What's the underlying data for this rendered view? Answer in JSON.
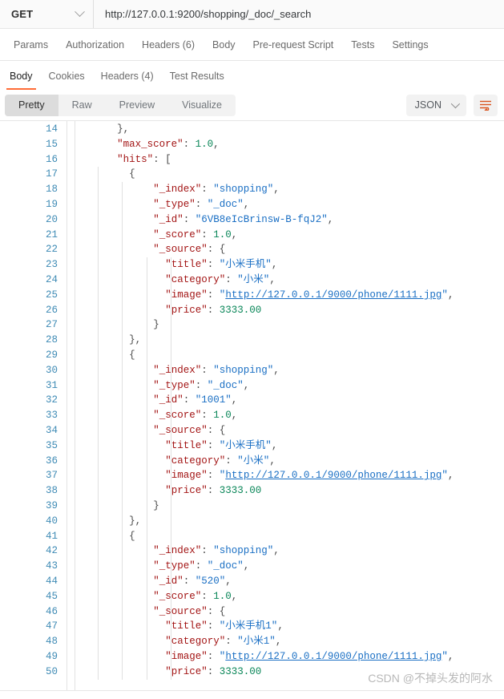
{
  "theme": {
    "accent": "#ff6c37",
    "link": "#1a6fc4",
    "key": "#a31515",
    "number": "#098658",
    "linenum": "#3f8bb5"
  },
  "request_bar": {
    "method": "GET",
    "url": "http://127.0.0.1:9200/shopping/_doc/_search",
    "method_chevron": "chevron-down-icon"
  },
  "request_tabs": [
    {
      "label": "Params"
    },
    {
      "label": "Authorization"
    },
    {
      "label": "Headers (6)"
    },
    {
      "label": "Body"
    },
    {
      "label": "Pre-request Script"
    },
    {
      "label": "Tests"
    },
    {
      "label": "Settings"
    }
  ],
  "response_tabs": [
    {
      "label": "Body",
      "active": true
    },
    {
      "label": "Cookies",
      "active": false
    },
    {
      "label": "Headers (4)",
      "active": false
    },
    {
      "label": "Test Results",
      "active": false
    }
  ],
  "format_bar": {
    "modes": [
      {
        "label": "Pretty",
        "active": true
      },
      {
        "label": "Raw",
        "active": false
      },
      {
        "label": "Preview",
        "active": false
      },
      {
        "label": "Visualize",
        "active": false
      }
    ],
    "language": "JSON",
    "language_chevron": "chevron-down-icon",
    "wrap_button": "wrap-lines-icon"
  },
  "code": {
    "first_line_number": 14,
    "lines": [
      {
        "n": 14,
        "indent": 3,
        "tokens": [
          {
            "t": "},",
            "c": "p"
          }
        ]
      },
      {
        "n": 15,
        "indent": 3,
        "tokens": [
          {
            "t": "\"max_score\"",
            "c": "k"
          },
          {
            "t": ": ",
            "c": "p"
          },
          {
            "t": "1.0",
            "c": "n"
          },
          {
            "t": ",",
            "c": "p"
          }
        ]
      },
      {
        "n": 16,
        "indent": 3,
        "tokens": [
          {
            "t": "\"hits\"",
            "c": "k"
          },
          {
            "t": ": [",
            "c": "p"
          }
        ]
      },
      {
        "n": 17,
        "indent": 4,
        "tokens": [
          {
            "t": "{",
            "c": "p"
          }
        ]
      },
      {
        "n": 18,
        "indent": 6,
        "tokens": [
          {
            "t": "\"_index\"",
            "c": "k"
          },
          {
            "t": ": ",
            "c": "p"
          },
          {
            "t": "\"shopping\"",
            "c": "s"
          },
          {
            "t": ",",
            "c": "p"
          }
        ]
      },
      {
        "n": 19,
        "indent": 6,
        "tokens": [
          {
            "t": "\"_type\"",
            "c": "k"
          },
          {
            "t": ": ",
            "c": "p"
          },
          {
            "t": "\"_doc\"",
            "c": "s"
          },
          {
            "t": ",",
            "c": "p"
          }
        ]
      },
      {
        "n": 20,
        "indent": 6,
        "tokens": [
          {
            "t": "\"_id\"",
            "c": "k"
          },
          {
            "t": ": ",
            "c": "p"
          },
          {
            "t": "\"6VB8eIcBrinsw-B-fqJ2\"",
            "c": "s"
          },
          {
            "t": ",",
            "c": "p"
          }
        ]
      },
      {
        "n": 21,
        "indent": 6,
        "tokens": [
          {
            "t": "\"_score\"",
            "c": "k"
          },
          {
            "t": ": ",
            "c": "p"
          },
          {
            "t": "1.0",
            "c": "n"
          },
          {
            "t": ",",
            "c": "p"
          }
        ]
      },
      {
        "n": 22,
        "indent": 6,
        "tokens": [
          {
            "t": "\"_source\"",
            "c": "k"
          },
          {
            "t": ": {",
            "c": "p"
          }
        ]
      },
      {
        "n": 23,
        "indent": 7,
        "tokens": [
          {
            "t": "\"title\"",
            "c": "k"
          },
          {
            "t": ": ",
            "c": "p"
          },
          {
            "t": "\"小米手机\"",
            "c": "s"
          },
          {
            "t": ",",
            "c": "p"
          }
        ]
      },
      {
        "n": 24,
        "indent": 7,
        "tokens": [
          {
            "t": "\"category\"",
            "c": "k"
          },
          {
            "t": ": ",
            "c": "p"
          },
          {
            "t": "\"小米\"",
            "c": "s"
          },
          {
            "t": ",",
            "c": "p"
          }
        ]
      },
      {
        "n": 25,
        "indent": 7,
        "tokens": [
          {
            "t": "\"image\"",
            "c": "k"
          },
          {
            "t": ": ",
            "c": "p"
          },
          {
            "t": "\"",
            "c": "s"
          },
          {
            "t": "http://127.0.0.1/9000/phone/1111.jpg",
            "c": "lnk"
          },
          {
            "t": "\"",
            "c": "s"
          },
          {
            "t": ",",
            "c": "p"
          }
        ]
      },
      {
        "n": 26,
        "indent": 7,
        "tokens": [
          {
            "t": "\"price\"",
            "c": "k"
          },
          {
            "t": ": ",
            "c": "p"
          },
          {
            "t": "3333.00",
            "c": "n"
          }
        ]
      },
      {
        "n": 27,
        "indent": 6,
        "tokens": [
          {
            "t": "}",
            "c": "p"
          }
        ]
      },
      {
        "n": 28,
        "indent": 4,
        "tokens": [
          {
            "t": "},",
            "c": "p"
          }
        ]
      },
      {
        "n": 29,
        "indent": 4,
        "tokens": [
          {
            "t": "{",
            "c": "p"
          }
        ]
      },
      {
        "n": 30,
        "indent": 6,
        "tokens": [
          {
            "t": "\"_index\"",
            "c": "k"
          },
          {
            "t": ": ",
            "c": "p"
          },
          {
            "t": "\"shopping\"",
            "c": "s"
          },
          {
            "t": ",",
            "c": "p"
          }
        ]
      },
      {
        "n": 31,
        "indent": 6,
        "tokens": [
          {
            "t": "\"_type\"",
            "c": "k"
          },
          {
            "t": ": ",
            "c": "p"
          },
          {
            "t": "\"_doc\"",
            "c": "s"
          },
          {
            "t": ",",
            "c": "p"
          }
        ]
      },
      {
        "n": 32,
        "indent": 6,
        "tokens": [
          {
            "t": "\"_id\"",
            "c": "k"
          },
          {
            "t": ": ",
            "c": "p"
          },
          {
            "t": "\"1001\"",
            "c": "s"
          },
          {
            "t": ",",
            "c": "p"
          }
        ]
      },
      {
        "n": 33,
        "indent": 6,
        "tokens": [
          {
            "t": "\"_score\"",
            "c": "k"
          },
          {
            "t": ": ",
            "c": "p"
          },
          {
            "t": "1.0",
            "c": "n"
          },
          {
            "t": ",",
            "c": "p"
          }
        ]
      },
      {
        "n": 34,
        "indent": 6,
        "tokens": [
          {
            "t": "\"_source\"",
            "c": "k"
          },
          {
            "t": ": {",
            "c": "p"
          }
        ]
      },
      {
        "n": 35,
        "indent": 7,
        "tokens": [
          {
            "t": "\"title\"",
            "c": "k"
          },
          {
            "t": ": ",
            "c": "p"
          },
          {
            "t": "\"小米手机\"",
            "c": "s"
          },
          {
            "t": ",",
            "c": "p"
          }
        ]
      },
      {
        "n": 36,
        "indent": 7,
        "tokens": [
          {
            "t": "\"category\"",
            "c": "k"
          },
          {
            "t": ": ",
            "c": "p"
          },
          {
            "t": "\"小米\"",
            "c": "s"
          },
          {
            "t": ",",
            "c": "p"
          }
        ]
      },
      {
        "n": 37,
        "indent": 7,
        "tokens": [
          {
            "t": "\"image\"",
            "c": "k"
          },
          {
            "t": ": ",
            "c": "p"
          },
          {
            "t": "\"",
            "c": "s"
          },
          {
            "t": "http://127.0.0.1/9000/phone/1111.jpg",
            "c": "lnk"
          },
          {
            "t": "\"",
            "c": "s"
          },
          {
            "t": ",",
            "c": "p"
          }
        ]
      },
      {
        "n": 38,
        "indent": 7,
        "tokens": [
          {
            "t": "\"price\"",
            "c": "k"
          },
          {
            "t": ": ",
            "c": "p"
          },
          {
            "t": "3333.00",
            "c": "n"
          }
        ]
      },
      {
        "n": 39,
        "indent": 6,
        "tokens": [
          {
            "t": "}",
            "c": "p"
          }
        ]
      },
      {
        "n": 40,
        "indent": 4,
        "tokens": [
          {
            "t": "},",
            "c": "p"
          }
        ]
      },
      {
        "n": 41,
        "indent": 4,
        "tokens": [
          {
            "t": "{",
            "c": "p"
          }
        ]
      },
      {
        "n": 42,
        "indent": 6,
        "tokens": [
          {
            "t": "\"_index\"",
            "c": "k"
          },
          {
            "t": ": ",
            "c": "p"
          },
          {
            "t": "\"shopping\"",
            "c": "s"
          },
          {
            "t": ",",
            "c": "p"
          }
        ]
      },
      {
        "n": 43,
        "indent": 6,
        "tokens": [
          {
            "t": "\"_type\"",
            "c": "k"
          },
          {
            "t": ": ",
            "c": "p"
          },
          {
            "t": "\"_doc\"",
            "c": "s"
          },
          {
            "t": ",",
            "c": "p"
          }
        ]
      },
      {
        "n": 44,
        "indent": 6,
        "tokens": [
          {
            "t": "\"_id\"",
            "c": "k"
          },
          {
            "t": ": ",
            "c": "p"
          },
          {
            "t": "\"520\"",
            "c": "s"
          },
          {
            "t": ",",
            "c": "p"
          }
        ]
      },
      {
        "n": 45,
        "indent": 6,
        "tokens": [
          {
            "t": "\"_score\"",
            "c": "k"
          },
          {
            "t": ": ",
            "c": "p"
          },
          {
            "t": "1.0",
            "c": "n"
          },
          {
            "t": ",",
            "c": "p"
          }
        ]
      },
      {
        "n": 46,
        "indent": 6,
        "tokens": [
          {
            "t": "\"_source\"",
            "c": "k"
          },
          {
            "t": ": {",
            "c": "p"
          }
        ]
      },
      {
        "n": 47,
        "indent": 7,
        "tokens": [
          {
            "t": "\"title\"",
            "c": "k"
          },
          {
            "t": ": ",
            "c": "p"
          },
          {
            "t": "\"小米手机1\"",
            "c": "s"
          },
          {
            "t": ",",
            "c": "p"
          }
        ]
      },
      {
        "n": 48,
        "indent": 7,
        "tokens": [
          {
            "t": "\"category\"",
            "c": "k"
          },
          {
            "t": ": ",
            "c": "p"
          },
          {
            "t": "\"小米1\"",
            "c": "s"
          },
          {
            "t": ",",
            "c": "p"
          }
        ]
      },
      {
        "n": 49,
        "indent": 7,
        "tokens": [
          {
            "t": "\"image\"",
            "c": "k"
          },
          {
            "t": ": ",
            "c": "p"
          },
          {
            "t": "\"",
            "c": "s"
          },
          {
            "t": "http://127.0.0.1/9000/phone/1111.jpg",
            "c": "lnk"
          },
          {
            "t": "\"",
            "c": "s"
          },
          {
            "t": ",",
            "c": "p"
          }
        ]
      },
      {
        "n": 50,
        "indent": 7,
        "tokens": [
          {
            "t": "\"price\"",
            "c": "k"
          },
          {
            "t": ": ",
            "c": "p"
          },
          {
            "t": "3333.00",
            "c": "n"
          }
        ]
      }
    ]
  },
  "watermark": {
    "text": "CSDN @不掉头发的阿水"
  }
}
